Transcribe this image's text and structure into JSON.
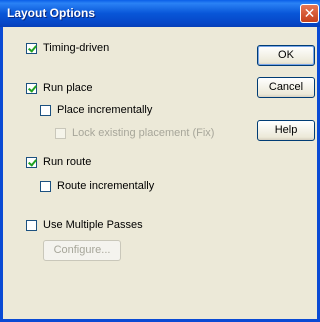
{
  "window": {
    "title": "Layout Options"
  },
  "options": {
    "timing_driven": {
      "label": "Timing-driven",
      "checked": true
    },
    "run_place": {
      "label": "Run place",
      "checked": true
    },
    "place_incrementally": {
      "label": "Place incrementally",
      "checked": false
    },
    "lock_existing": {
      "label": "Lock existing placement (Fix)",
      "checked": false,
      "disabled": true
    },
    "run_route": {
      "label": "Run route",
      "checked": true
    },
    "route_incrementally": {
      "label": "Route incrementally",
      "checked": false
    },
    "multiple_passes": {
      "label": "Use Multiple Passes",
      "checked": false
    }
  },
  "buttons": {
    "ok": "OK",
    "cancel": "Cancel",
    "help": "Help",
    "configure": "Configure..."
  }
}
